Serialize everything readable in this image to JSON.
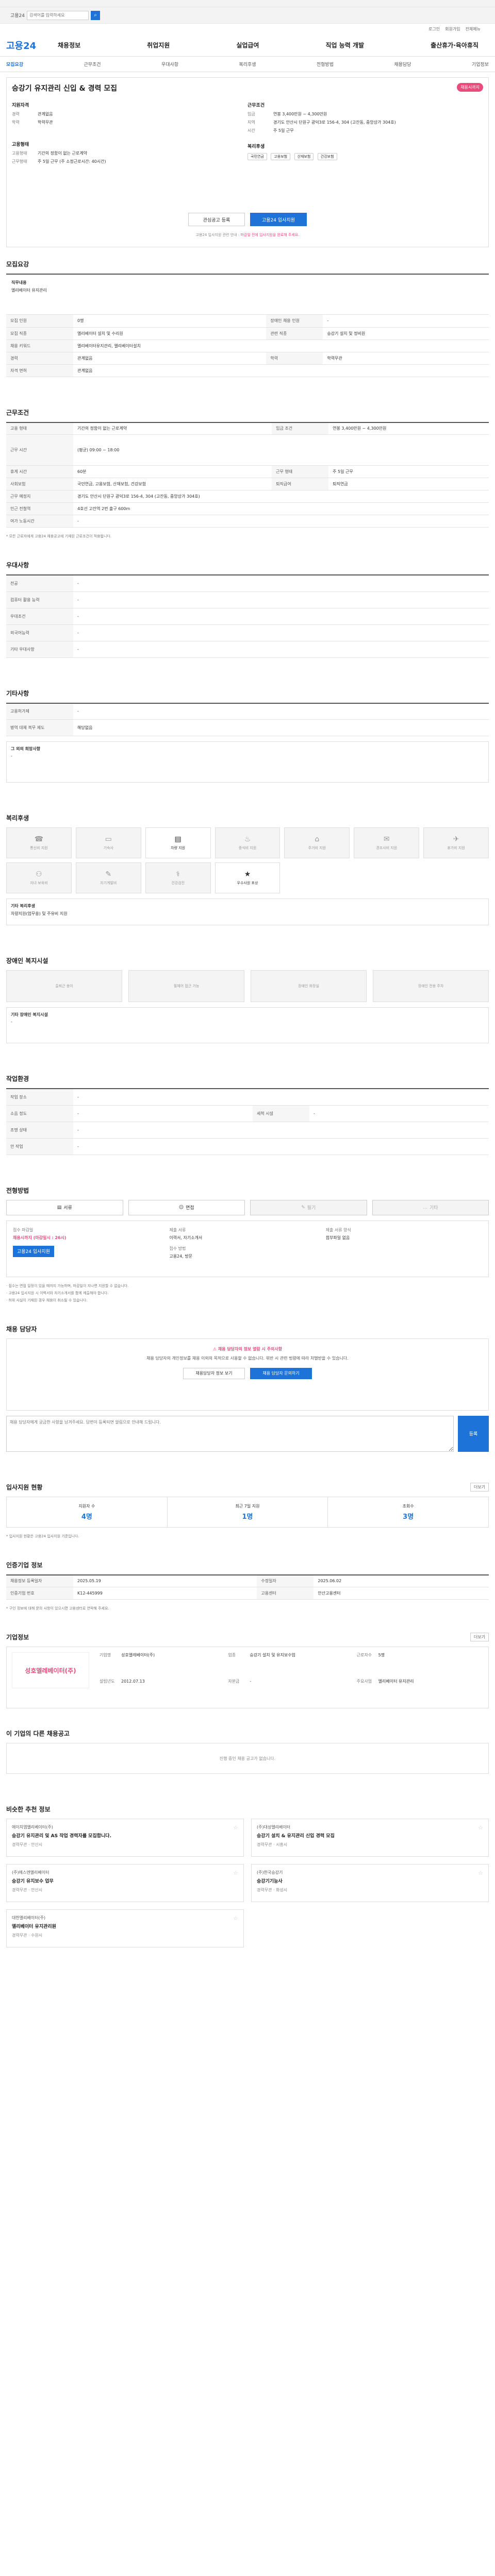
{
  "topbar": {
    "brand": "고용24",
    "search_placeholder": "검색어를 입력하세요",
    "search_btn": "⌕"
  },
  "util": [
    "로그인",
    "회원가입",
    "전체메뉴"
  ],
  "nav": {
    "logo": "고용24",
    "menu": [
      "채용정보",
      "취업지원",
      "실업급여",
      "직업 능력 개발",
      "출산휴가·육아휴직"
    ]
  },
  "tabs": [
    "모집요강",
    "근무조건",
    "우대사항",
    "복리후생",
    "전형방법",
    "채용담당",
    "기업정보"
  ],
  "job": {
    "title": "승강기 유지관리 신입 & 경력 모집",
    "badge": "채용시까지",
    "company_heading": "지원자격",
    "company_rows": [
      {
        "k": "경력",
        "v": "관계없음"
      },
      {
        "k": "학력",
        "v": "학력무관"
      }
    ],
    "employ_heading": "고용형태",
    "employ_rows": [
      {
        "k": "고용형태",
        "v": "기간의 정함이 없는 근로계약"
      },
      {
        "k": "근무형태",
        "v": "주 5일 근무 (주 소정근로시간: 40시간)"
      }
    ],
    "work_heading": "근무조건",
    "work_rows": [
      {
        "k": "임금",
        "v": "연봉 3,400만원 ~ 4,300만원"
      },
      {
        "k": "지역",
        "v": "경기도 안산시 단원구 광덕3로 156-4, 304 (고잔동, 중앙상가 304호)"
      },
      {
        "k": "시간",
        "v": "주 5일 근무"
      }
    ],
    "welfare_heading": "복리후생",
    "welfare_chips": [
      "국민연금",
      "고용보험",
      "산재보험",
      "건강보험"
    ],
    "btn_scrap": "관심공고 등록",
    "btn_apply": "고용24 입사지원",
    "note_prefix": "고용24 입사지원 관련 안내 : ",
    "note_highlight": "마감일 전에 입사지원을 완료해 주세요."
  },
  "sections": {
    "recruit": "모집요강",
    "work": "근무조건",
    "prefer": "우대사항",
    "other": "기타사항",
    "benefit": "복리후생",
    "disabled": "장애인 복지시설",
    "workplace": "작업환경",
    "selection": "전형방법",
    "manager": "채용 담당자",
    "stats": "입사지원 현황",
    "registration": "인증기업 정보",
    "company": "기업정보",
    "others": "이 기업의 다른 채용공고",
    "similar": "비슷한 추천 정보"
  },
  "recruit": {
    "duty_title": "직무내용",
    "duty_text": "엘리베이터 유지관리",
    "rows": [
      {
        "k": "모집 인원",
        "v": "0명",
        "k2": "장애인 채용 인원",
        "v2": "-"
      },
      {
        "k": "모집 직종",
        "v": "엘리베이터 설치 및 수리원",
        "k2": "관련 직종",
        "v2": "승강기 설치 및 정비원"
      },
      {
        "k": "채용 키워드",
        "v": "엘리베이터유지관리, 엘리베이터설치",
        "k2": "",
        "v2": ""
      },
      {
        "k": "경력",
        "v": "관계없음",
        "k2": "학력",
        "v2": "학력무관"
      },
      {
        "k": "자격 면허",
        "v": "관계없음",
        "k2": "",
        "v2": ""
      }
    ]
  },
  "work": {
    "rows": [
      {
        "k": "고용 형태",
        "v": "기간의 정함이 없는 근로계약",
        "k2": "임금 조건",
        "v2": "연봉 3,400만원 ~ 4,300만원"
      },
      {
        "k": "근무 시간",
        "v": "(평균) 09:00 ~ 18:00",
        "k2": "",
        "v2": ""
      },
      {
        "k": "휴게 시간",
        "v": "60분",
        "k2": "근무 형태",
        "v2": "주 5일 근무"
      },
      {
        "k": "사회보험",
        "v": "국민연금, 고용보험, 산재보험, 건강보험",
        "k2": "퇴직급여",
        "v2": "퇴직연금"
      },
      {
        "k": "근무 예정지",
        "v": "경기도 안산시 단원구 광덕3로 156-4, 304 (고잔동, 중앙상가 304호)",
        "k2": "",
        "v2": ""
      },
      {
        "k": "인근 전철역",
        "v": "4호선 고잔역 2번 출구 600m",
        "k2": "",
        "v2": ""
      },
      {
        "k": "여가 노동시간",
        "v": "-",
        "k2": "",
        "v2": ""
      }
    ],
    "note": "* 모든 근로자에게 고용24 채용공고에 기재된 근로조건이 적용됩니다."
  },
  "prefer": {
    "rows": [
      {
        "k": "전공",
        "v": "-"
      },
      {
        "k": "컴퓨터 활용 능력",
        "v": "-"
      },
      {
        "k": "우대조건",
        "v": "-"
      },
      {
        "k": "외국어능력",
        "v": "-"
      },
      {
        "k": "기타 우대사항",
        "v": "-"
      }
    ]
  },
  "other": {
    "rows": [
      {
        "k": "고용허가제",
        "v": "-"
      },
      {
        "k": "병역 대체 복무 제도",
        "v": "해당없음"
      }
    ],
    "etc_title": "그 외의 희망사항",
    "etc_text": "-"
  },
  "benefit": {
    "items": [
      {
        "icon": "☎",
        "label": "통신비 지원",
        "on": false
      },
      {
        "icon": "▭",
        "label": "기숙사",
        "on": false
      },
      {
        "icon": "▤",
        "label": "차량 지원",
        "on": true
      },
      {
        "icon": "♨",
        "label": "중식비 지원",
        "on": false
      },
      {
        "icon": "⌂",
        "label": "주거비 지원",
        "on": false
      },
      {
        "icon": "✉",
        "label": "경조사비 지원",
        "on": false
      },
      {
        "icon": "✈",
        "label": "휴가비 지원",
        "on": false
      },
      {
        "icon": "⚇",
        "label": "자녀 보육비",
        "on": false
      },
      {
        "icon": "✎",
        "label": "자기계발비",
        "on": false
      },
      {
        "icon": "⚕",
        "label": "건강검진",
        "on": false
      },
      {
        "icon": "★",
        "label": "우수사원 포상",
        "on": true
      }
    ],
    "etc_title": "기타 복리후생",
    "etc_text": "차량지원(업무용) 및 주유비 지원"
  },
  "disabled": {
    "items": [
      "출퇴근 용이",
      "휠체어 접근 가능",
      "장애인 화장실",
      "장애인 전용 주차"
    ],
    "etc_title": "기타 장애인 복지시설",
    "etc_text": "-"
  },
  "workplace": {
    "rows": [
      {
        "k": "작업 장소",
        "v": "-",
        "k2": "",
        "v2": ""
      },
      {
        "k": "소음 정도",
        "v": "-",
        "k2": "세척 시설",
        "v2": "-"
      },
      {
        "k": "조명 상태",
        "v": "-",
        "k2": "",
        "v2": ""
      },
      {
        "k": "안 작업",
        "v": "-",
        "k2": "",
        "v2": ""
      }
    ]
  },
  "selection": {
    "methods": [
      {
        "label": "서류",
        "on": true
      },
      {
        "label": "면접",
        "on": true
      },
      {
        "label": "필기",
        "on": false
      },
      {
        "label": "기타",
        "on": false
      }
    ],
    "col1_lbl": "접수 마감일",
    "col1_val": "채용시까지 (마감일시 : 26시)",
    "col2_lbl": "제출 서류",
    "col2_val": "이력서, 자기소개서",
    "col3_lbl": "접수 방법",
    "col3_val": "고용24, 방문",
    "col4_lbl": "제출 서류 양식",
    "col4_val": "첨부파일 없음",
    "apply_btn": "고용24 입사지원",
    "notes": [
      "· 접수는 면접 일정이 있을 때까지 가능하며, 마감일이 지나면 지원할 수 없습니다.",
      "· 고용24 입사지원 시 이력서와 자기소개서를 함께 제출해야 합니다.",
      "· 허위 사실이 기재된 경우 채용이 취소될 수 있습니다."
    ]
  },
  "manager": {
    "alert": "채용 담당자의 정보 열람 시 주의사항",
    "desc": "채용 담당자의 개인정보를 채용 이외의 목적으로 사용할 수 없습니다. 위반 시 관련 법령에 따라 처벌받을 수 있습니다.",
    "btn1": "채용담당자 정보 보기",
    "btn2": "채용 담당자 문의하기"
  },
  "qna": {
    "placeholder": "채용 담당자에게 궁금한 사항을 남겨주세요. 답변이 등록되면 알림으로 안내해 드립니다.",
    "submit": "등록"
  },
  "stats": {
    "items": [
      {
        "lbl": "지원자 수",
        "num": "4명"
      },
      {
        "lbl": "최근 7일 지원",
        "num": "1명"
      },
      {
        "lbl": "조회수",
        "num": "3명"
      }
    ],
    "more": "더보기",
    "note": "* 입사지원 현황은 고용24 입사지원 기준입니다."
  },
  "registration": {
    "rows": [
      {
        "k": "채용정보 등록일자",
        "v": "2025.05.19",
        "k2": "수정일자",
        "v2": "2025.06.02"
      },
      {
        "k": "인증기업 번호",
        "v": "K12-445999",
        "k2": "고용센터",
        "v2": "안산고용센터"
      }
    ],
    "tip": "* 구인 정보에 대해 문의 사항이 있으시면 고용센터로 연락해 주세요."
  },
  "company": {
    "logo_text": "성호엘레베이터(주)",
    "more": "더보기",
    "rows": [
      {
        "k": "기업명",
        "v": "성호엘레베이터(주)"
      },
      {
        "k": "업종",
        "v": "승강기 설치 및 유지보수업"
      },
      {
        "k": "근로자수",
        "v": "5명"
      },
      {
        "k": "설립년도",
        "v": "2012.07.13"
      },
      {
        "k": "자본금",
        "v": "-"
      },
      {
        "k": "주요사업",
        "v": "엘리베이터 유지관리"
      }
    ]
  },
  "others_empty": "진행 중인 채용 공고가 없습니다.",
  "similar": {
    "cards": [
      {
        "cname": "에이치엠엘리베이터(주)",
        "title": "승강기 유지관리 및 AS 작업 경력자를 모집합니다.",
        "meta": "경력무관 · 안산시"
      },
      {
        "cname": "(주)대성엘리베이터",
        "title": "승강기 설치 & 유지관리 신입 경력 모집",
        "meta": "경력무관 · 시흥시"
      },
      {
        "cname": "(주)에스엔엘리베이터",
        "title": "승강기 유지보수 업무",
        "meta": "경력무관 · 안산시"
      },
      {
        "cname": "(주)한국승강기",
        "title": "승강기기능사",
        "meta": "경력무관 · 화성시"
      },
      {
        "cname": "대한엘리베이터(주)",
        "title": "엘리베이터 유지관리원",
        "meta": "경력무관 · 수원시"
      }
    ]
  }
}
